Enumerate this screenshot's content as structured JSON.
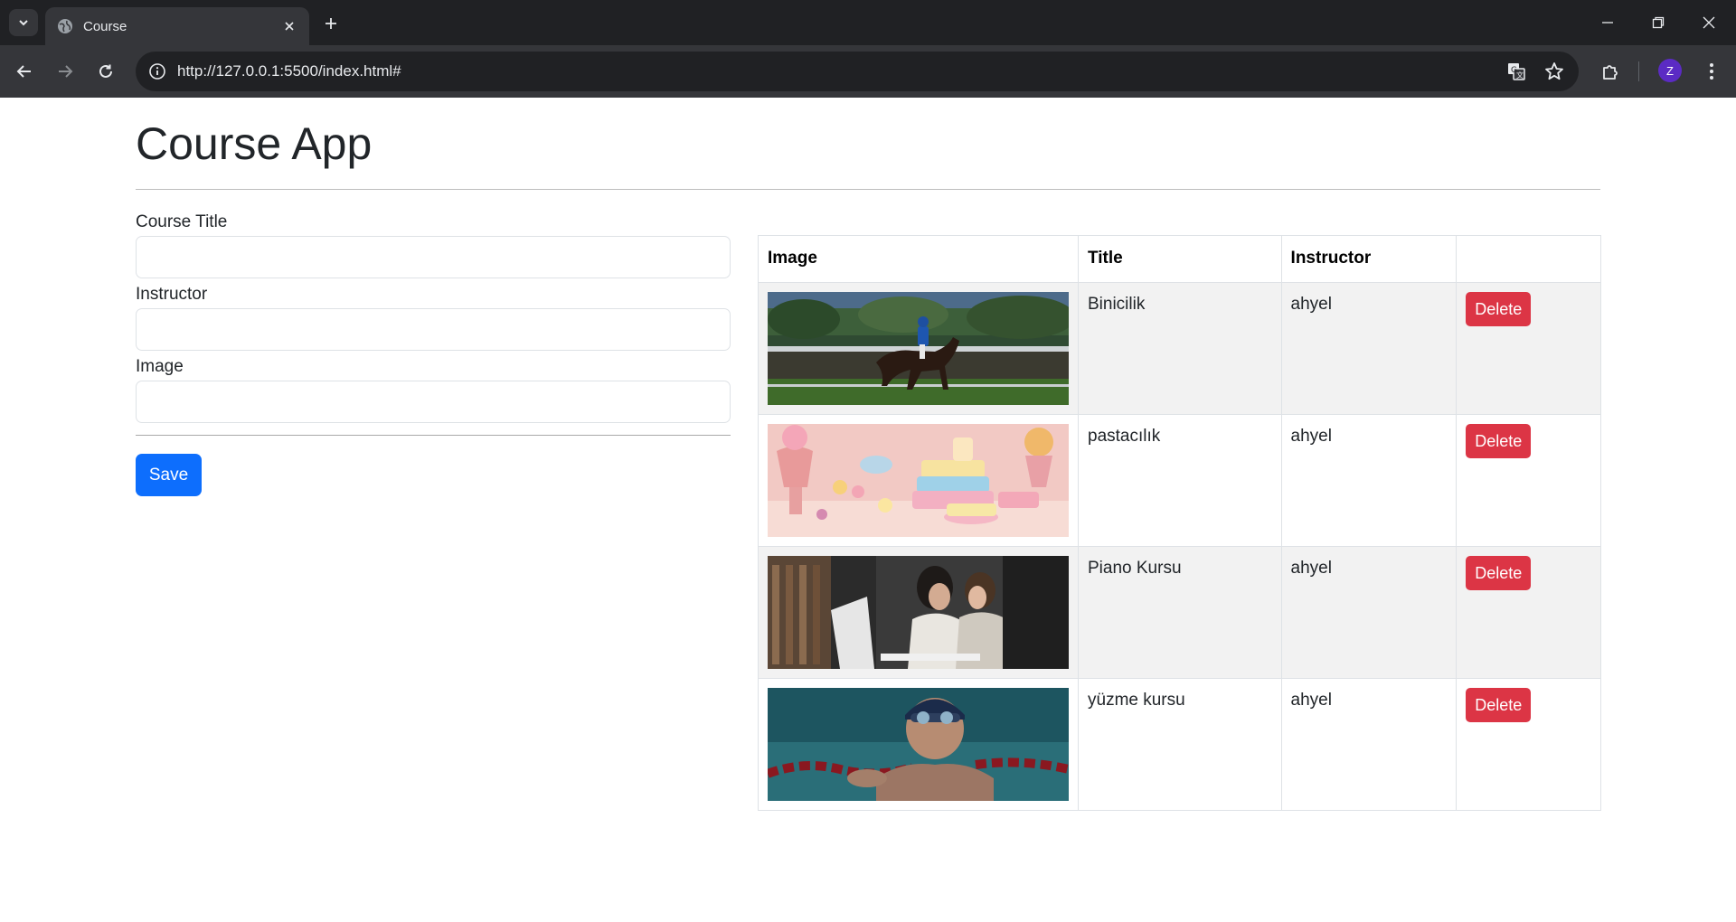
{
  "browser": {
    "tab_title": "Course",
    "url": "http://127.0.0.1:5500/index.html#",
    "profile_initial": "Z"
  },
  "app": {
    "title": "Course App"
  },
  "form": {
    "course_title_label": "Course Title",
    "course_title_value": "",
    "instructor_label": "Instructor",
    "instructor_value": "",
    "image_label": "Image",
    "image_value": "",
    "save_label": "Save"
  },
  "table": {
    "headers": [
      "Image",
      "Title",
      "Instructor",
      ""
    ],
    "rows": [
      {
        "image": "horse-riding-photo",
        "title": "Binicilik",
        "instructor": "ahyel",
        "action": "Delete"
      },
      {
        "image": "pastry-cakes-photo",
        "title": "pastacılık",
        "instructor": "ahyel",
        "action": "Delete"
      },
      {
        "image": "piano-lesson-photo",
        "title": "Piano Kursu",
        "instructor": "ahyel",
        "action": "Delete"
      },
      {
        "image": "swimming-photo",
        "title": "yüzme kursu",
        "instructor": "ahyel",
        "action": "Delete"
      }
    ]
  },
  "colors": {
    "primary": "#0d6efd",
    "danger": "#dc3545",
    "stripe": "#f2f2f2"
  }
}
